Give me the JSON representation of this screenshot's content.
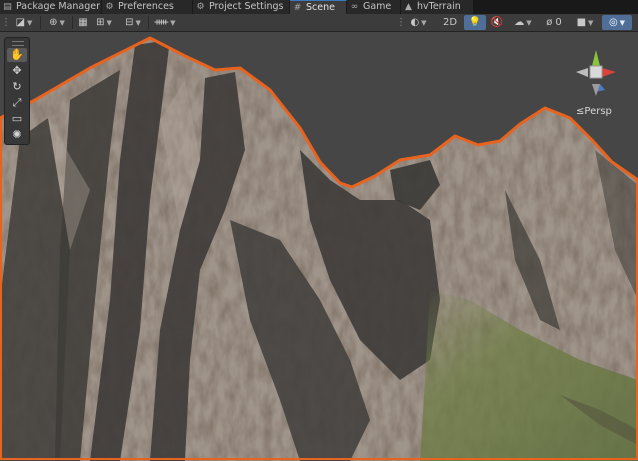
{
  "tabs": [
    {
      "label": "Package Manager",
      "icon": "package-icon"
    },
    {
      "label": "Preferences",
      "icon": "gear-icon"
    },
    {
      "label": "Project Settings",
      "icon": "gear-icon"
    },
    {
      "label": "Scene",
      "icon": "scene-grid-icon",
      "active": true
    },
    {
      "label": "Game",
      "icon": "gamepad-icon"
    },
    {
      "label": "hvTerrain",
      "icon": "terrain-icon"
    }
  ],
  "toolbar": {
    "mode_2d": "2D",
    "selected_tool_color": "#4f6f98"
  },
  "tools": [
    "hand-icon",
    "move-icon",
    "rotate-icon",
    "scale-icon",
    "rect-icon",
    "transform-icon"
  ],
  "gizmo": {
    "projection_label": "Persp"
  },
  "colors": {
    "sky": "#464646",
    "terrain_outline": "#e8641e",
    "rock_light": "#9a8f86",
    "rock_dark": "#3f3d3b",
    "grass": "#6b7a45"
  }
}
